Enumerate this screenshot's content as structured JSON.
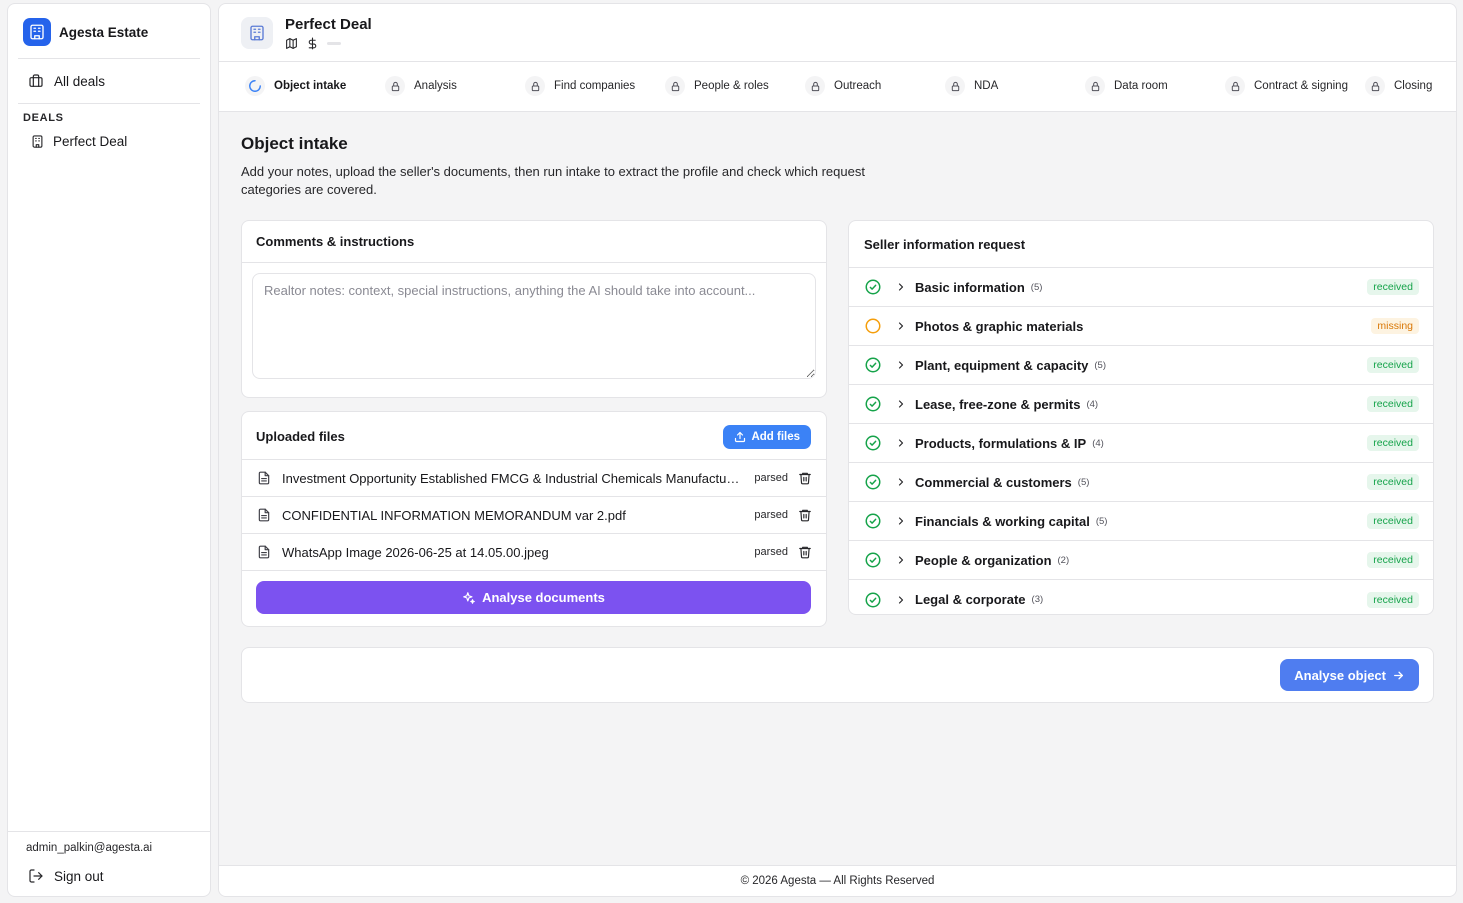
{
  "sidebar": {
    "brand": "Agesta Estate",
    "all_deals": "All deals",
    "section_label": "DEALS",
    "deals": [
      {
        "label": "Perfect Deal"
      }
    ],
    "user_email": "admin_palkin@agesta.ai",
    "sign_out": "Sign out"
  },
  "header": {
    "title": "Perfect Deal"
  },
  "stepper": {
    "steps": [
      {
        "label": "Object intake",
        "state": "active"
      },
      {
        "label": "Analysis",
        "state": "locked"
      },
      {
        "label": "Find companies",
        "state": "locked"
      },
      {
        "label": "People & roles",
        "state": "locked"
      },
      {
        "label": "Outreach",
        "state": "locked"
      },
      {
        "label": "NDA",
        "state": "locked"
      },
      {
        "label": "Data room",
        "state": "locked"
      },
      {
        "label": "Contract & signing",
        "state": "locked"
      },
      {
        "label": "Closing",
        "state": "locked"
      }
    ]
  },
  "intake": {
    "title": "Object intake",
    "description": "Add your notes, upload the seller's documents, then run intake to extract the profile and check which request categories are covered."
  },
  "comments": {
    "title": "Comments & instructions",
    "placeholder": "Realtor notes: context, special instructions, anything the AI should take into account..."
  },
  "files": {
    "title": "Uploaded files",
    "add_label": "Add files",
    "items": [
      {
        "name": "Investment Opportunity Established FMCG & Industrial Chemicals Manufacturer.pdf",
        "status": "parsed"
      },
      {
        "name": "CONFIDENTIAL INFORMATION MEMORANDUM var 2.pdf",
        "status": "parsed"
      },
      {
        "name": "WhatsApp Image 2026-06-25 at 14.05.00.jpeg",
        "status": "parsed"
      }
    ],
    "analyse_label": "Analyse documents"
  },
  "request": {
    "title": "Seller information request",
    "items": [
      {
        "label": "Basic information",
        "count": "(5)",
        "status": "received"
      },
      {
        "label": "Photos & graphic materials",
        "count": "",
        "status": "missing"
      },
      {
        "label": "Plant, equipment & capacity",
        "count": "(5)",
        "status": "received"
      },
      {
        "label": "Lease, free-zone & permits",
        "count": "(4)",
        "status": "received"
      },
      {
        "label": "Products, formulations & IP",
        "count": "(4)",
        "status": "received"
      },
      {
        "label": "Commercial & customers",
        "count": "(5)",
        "status": "received"
      },
      {
        "label": "Financials & working capital",
        "count": "(5)",
        "status": "received"
      },
      {
        "label": "People & organization",
        "count": "(2)",
        "status": "received"
      },
      {
        "label": "Legal & corporate",
        "count": "(3)",
        "status": "received"
      }
    ]
  },
  "actions": {
    "analyse_object": "Analyse object"
  },
  "footer": {
    "text": "© 2026 Agesta — All Rights Reserved"
  },
  "colors": {
    "accent": "#3b82f6",
    "purple": "#7c52f0",
    "received": "#15a34a",
    "missing": "#d97706"
  }
}
